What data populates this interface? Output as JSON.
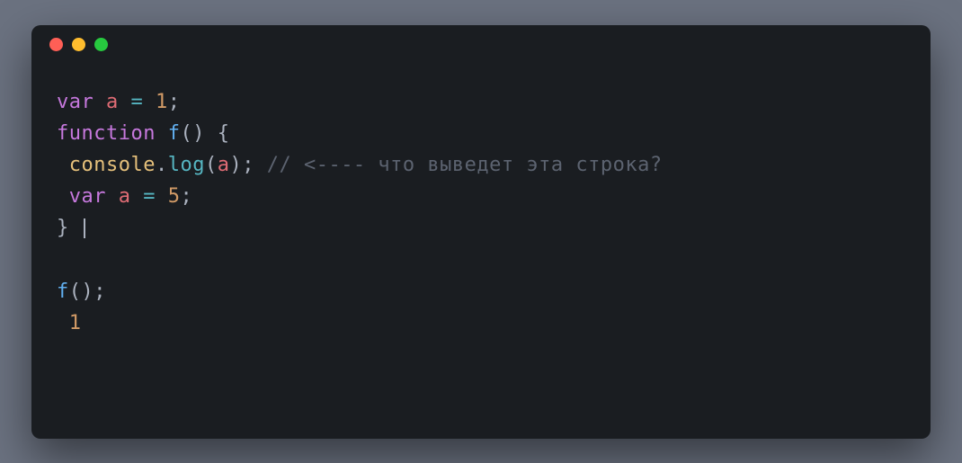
{
  "titlebar": {
    "buttons": [
      "close",
      "minimize",
      "maximize"
    ]
  },
  "code": {
    "line1": {
      "kw": "var",
      "var": "a",
      "op": "=",
      "num": "1",
      "semi": ";"
    },
    "line2": {
      "kw": "function",
      "fn": "f",
      "parens": "()",
      "brace": "{"
    },
    "line3": {
      "obj": "console",
      "dot": ".",
      "method": "log",
      "open": "(",
      "arg": "a",
      "close": ")",
      "semi": ";",
      "comment": "// <---- что выведет эта строка?"
    },
    "line4": {
      "kw": "var",
      "var": "a",
      "op": "=",
      "num": "5",
      "semi": ";"
    },
    "line5": {
      "brace": "}"
    },
    "line6": "",
    "line7": {
      "fn": "f",
      "parens": "()",
      "semi": ";"
    },
    "line8": {
      "num": "1"
    }
  }
}
